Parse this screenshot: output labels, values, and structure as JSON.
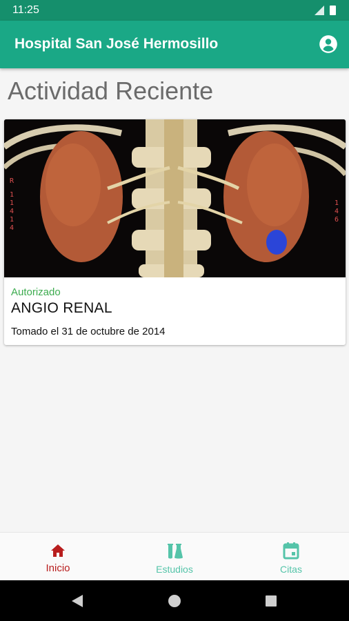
{
  "status_bar": {
    "time": "11:25"
  },
  "app_bar": {
    "title": "Hospital San José Hermosillo"
  },
  "section": {
    "title": "Actividad Reciente"
  },
  "study": {
    "status": "Autorizado",
    "name": "ANGIO RENAL",
    "date": "Tomado el 31 de octubre de 2014",
    "image_markers": {
      "left": [
        "R",
        "1",
        "1",
        "4",
        "1",
        "4"
      ],
      "right": [
        "1",
        "4",
        "6"
      ]
    }
  },
  "bottom_nav": {
    "items": [
      {
        "label": "Inicio",
        "icon": "home-icon",
        "active": true
      },
      {
        "label": "Estudios",
        "icon": "flask-icon",
        "active": false
      },
      {
        "label": "Citas",
        "icon": "calendar-icon",
        "active": false
      }
    ]
  },
  "colors": {
    "status_bar": "#158f6c",
    "app_bar": "#1aa886",
    "active_nav": "#b81d1d",
    "inactive_nav": "#55c4a9",
    "status_authorized": "#3cab4e"
  }
}
